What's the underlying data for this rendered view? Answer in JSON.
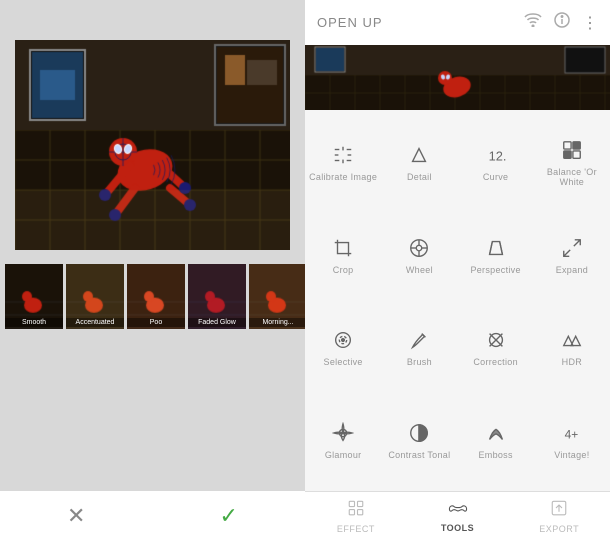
{
  "leftPanel": {
    "thumbnails": [
      {
        "label": "Smooth"
      },
      {
        "label": "Accentuated"
      },
      {
        "label": "Poo"
      },
      {
        "label": "Faded Glow"
      },
      {
        "label": "Morning..."
      }
    ],
    "cancelLabel": "✕",
    "confirmLabel": "✓"
  },
  "rightPanel": {
    "header": {
      "title": "OPEN UP"
    },
    "tools": [
      {
        "id": "calibrate",
        "label": "Calibrate Image",
        "icon": "calibrate"
      },
      {
        "id": "detail",
        "label": "Detail",
        "icon": "detail"
      },
      {
        "id": "curve",
        "label": "Curve",
        "icon": "curve"
      },
      {
        "id": "balance",
        "label": "Balance 'Or White",
        "icon": "balance"
      },
      {
        "id": "crop",
        "label": "Crop",
        "icon": "crop"
      },
      {
        "id": "wheel",
        "label": "Wheel",
        "icon": "wheel"
      },
      {
        "id": "perspective",
        "label": "Perspective",
        "icon": "perspective"
      },
      {
        "id": "expand",
        "label": "Expand",
        "icon": "expand"
      },
      {
        "id": "selective",
        "label": "Selective",
        "icon": "selective"
      },
      {
        "id": "brush",
        "label": "Brush",
        "icon": "brush"
      },
      {
        "id": "correction",
        "label": "Correction",
        "icon": "correction"
      },
      {
        "id": "hdr",
        "label": "HDR",
        "icon": "hdr"
      },
      {
        "id": "glamour",
        "label": "Glamour",
        "icon": "glamour"
      },
      {
        "id": "contrast",
        "label": "Contrast Tonal",
        "icon": "contrast"
      },
      {
        "id": "emboss",
        "label": "Emboss",
        "icon": "emboss"
      },
      {
        "id": "vintage",
        "label": "Vintage!",
        "icon": "vintage"
      }
    ],
    "bottomNav": [
      {
        "id": "effect",
        "label": "EFFECT",
        "icon": "grid"
      },
      {
        "id": "tools",
        "label": "TOOLS",
        "icon": "moustache",
        "active": true
      },
      {
        "id": "export",
        "label": "EXPORT",
        "icon": "export"
      }
    ]
  }
}
